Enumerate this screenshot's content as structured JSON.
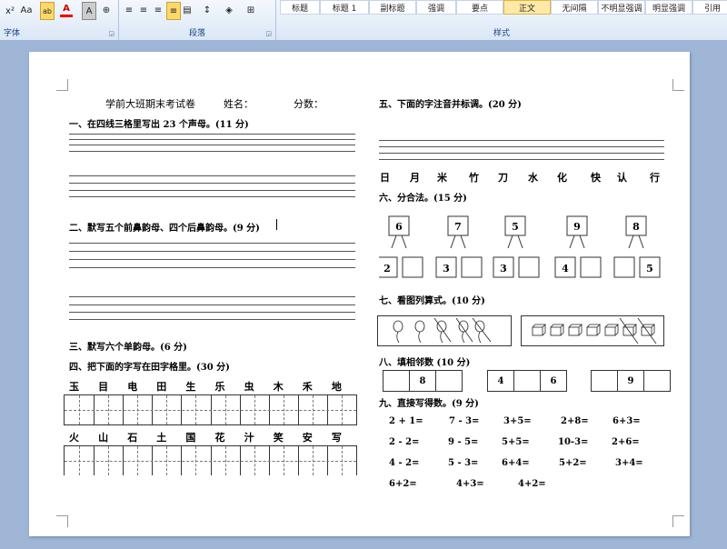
{
  "ribbon": {
    "font_group": "字体",
    "paragraph_group": "段落",
    "styles_group": "样式",
    "font_btn_sup": "x²",
    "font_btn_aa": "Aa",
    "font_btn_highlight": "ab",
    "font_btn_color": "A",
    "font_btn_char_shade": "A",
    "styles": [
      "标题",
      "标题 1",
      "副标题",
      "强调",
      "要点",
      "正文",
      "无间隔",
      "不明显强调",
      "明显强调",
      "引用"
    ],
    "active_style": "正文"
  },
  "doc": {
    "header": "学前大班期末考试卷",
    "name_label": "姓名：",
    "score_label": "分数：",
    "q1": "一、在四线三格里写出 23 个声母。(11 分)",
    "q2": "二、默写五个前鼻韵母、四个后鼻韵母。(9 分)",
    "q3": "三、默写六个单韵母。(6 分)",
    "q4": "四、把下面的字写在田字格里。(30 分)",
    "q4_row1": [
      "玉",
      "目",
      "电",
      "田",
      "生",
      "乐",
      "虫",
      "木",
      "禾",
      "地"
    ],
    "q4_row2": [
      "火",
      "山",
      "石",
      "土",
      "国",
      "花",
      "汁",
      "笑",
      "安",
      "写"
    ],
    "q5": "五、下面的字注音并标调。(20 分)",
    "q5_chars": [
      "日",
      "月",
      "米",
      "竹",
      "刀",
      "水",
      "化",
      "快",
      "认",
      "行"
    ],
    "q6": "六、分合法。(15 分)",
    "q6_items": [
      {
        "top": "6",
        "left": "2",
        "right": ""
      },
      {
        "top": "7",
        "left": "3",
        "right": ""
      },
      {
        "top": "5",
        "left": "3",
        "right": ""
      },
      {
        "top": "9",
        "left": "4",
        "right": ""
      },
      {
        "top": "8",
        "left": "",
        "right": "5"
      }
    ],
    "q7": "七、看图列算式。(10 分)",
    "q8": "八、填相邻数 (10 分)",
    "q8_groups": [
      [
        "",
        "8",
        ""
      ],
      [
        "4",
        "",
        "6"
      ],
      [
        "",
        "9",
        ""
      ]
    ],
    "q9": "九、直接写得数。(9 分)",
    "q9_rows": [
      [
        "2 + 1=",
        "7 - 3=",
        "3+5=",
        "2+8=",
        "6+3="
      ],
      [
        "2 - 2=",
        "9 - 5=",
        "5+5=",
        "10-3=",
        "2+6="
      ],
      [
        "4 - 2=",
        "5 - 3=",
        "6+4=",
        "5+2=",
        "3+4="
      ],
      [
        "6+2=",
        "4+3=",
        "4+2="
      ]
    ]
  }
}
